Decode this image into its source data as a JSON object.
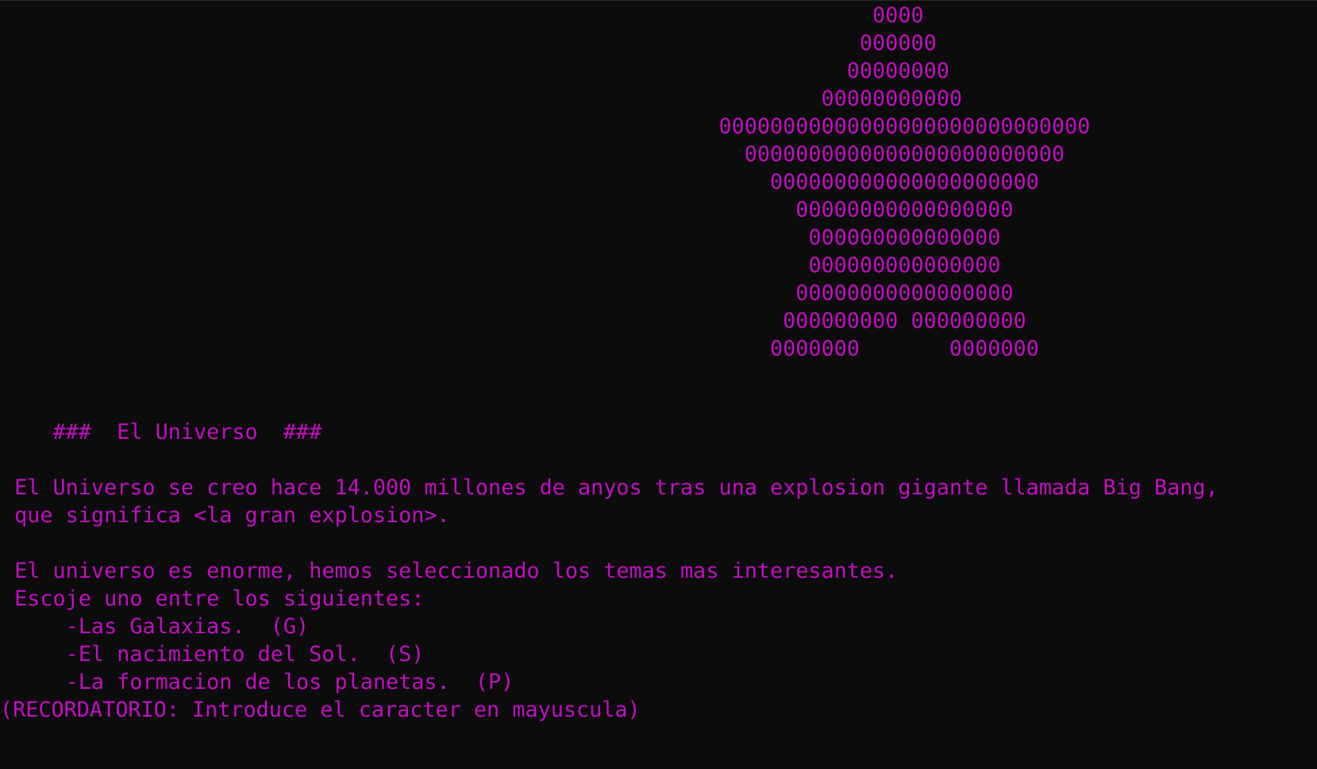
{
  "terminal": {
    "text_color": "#c20ec2",
    "background_color": "#0c0c0c",
    "ascii_art": [
      "                                                                    0000",
      "                                                                   000000",
      "                                                                  00000000",
      "                                                                00000000000",
      "                                                        00000000000000000000000000000",
      "                                                          0000000000000000000000000",
      "                                                            000000000000000000000",
      "                                                              00000000000000000",
      "                                                               000000000000000",
      "                                                               000000000000000",
      "                                                              00000000000000000",
      "                                                             000000000 000000000",
      "                                                            0000000       0000000"
    ],
    "title": "    ###  El Universo  ###",
    "intro": [
      " El Universo se creo hace 14.000 millones de anyos tras una explosion gigante llamada Big Bang,",
      " que significa <la gran explosion>."
    ],
    "prompt_lines": [
      " El universo es enorme, hemos seleccionado los temas mas interesantes.",
      " Escoje uno entre los siguientes:"
    ],
    "options": [
      "     -Las Galaxias.  (G)",
      "     -El nacimiento del Sol.  (S)",
      "     -La formacion de los planetas.  (P)"
    ],
    "reminder": "(RECORDATORIO: Introduce el caracter en mayuscula)"
  }
}
